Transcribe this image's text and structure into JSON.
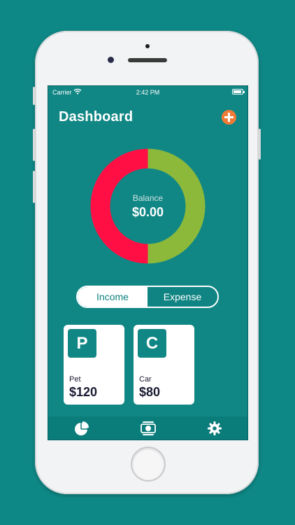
{
  "status_bar": {
    "carrier": "Carrier",
    "time": "2:42 PM"
  },
  "header": {
    "title": "Dashboard",
    "add_icon": "plus-icon"
  },
  "balance": {
    "label": "Balance",
    "value": "$0.00"
  },
  "chart_data": {
    "type": "pie",
    "categories": [
      "Expense",
      "Income"
    ],
    "values": [
      50,
      50
    ],
    "colors": [
      "#ff0f43",
      "#8cb93a"
    ],
    "title": ""
  },
  "toggle": {
    "income_label": "Income",
    "expense_label": "Expense",
    "selected": "Expense"
  },
  "cards": [
    {
      "letter": "P",
      "name": "Pet",
      "amount": "$120"
    },
    {
      "letter": "C",
      "name": "Car",
      "amount": "$80"
    }
  ],
  "tabbar": {
    "tabs": [
      "pie-chart-icon",
      "money-icon",
      "gear-icon"
    ]
  },
  "colors": {
    "background": "#0e8886",
    "accent": "#f07b36",
    "expense": "#ff0f43",
    "income": "#8cb93a"
  }
}
